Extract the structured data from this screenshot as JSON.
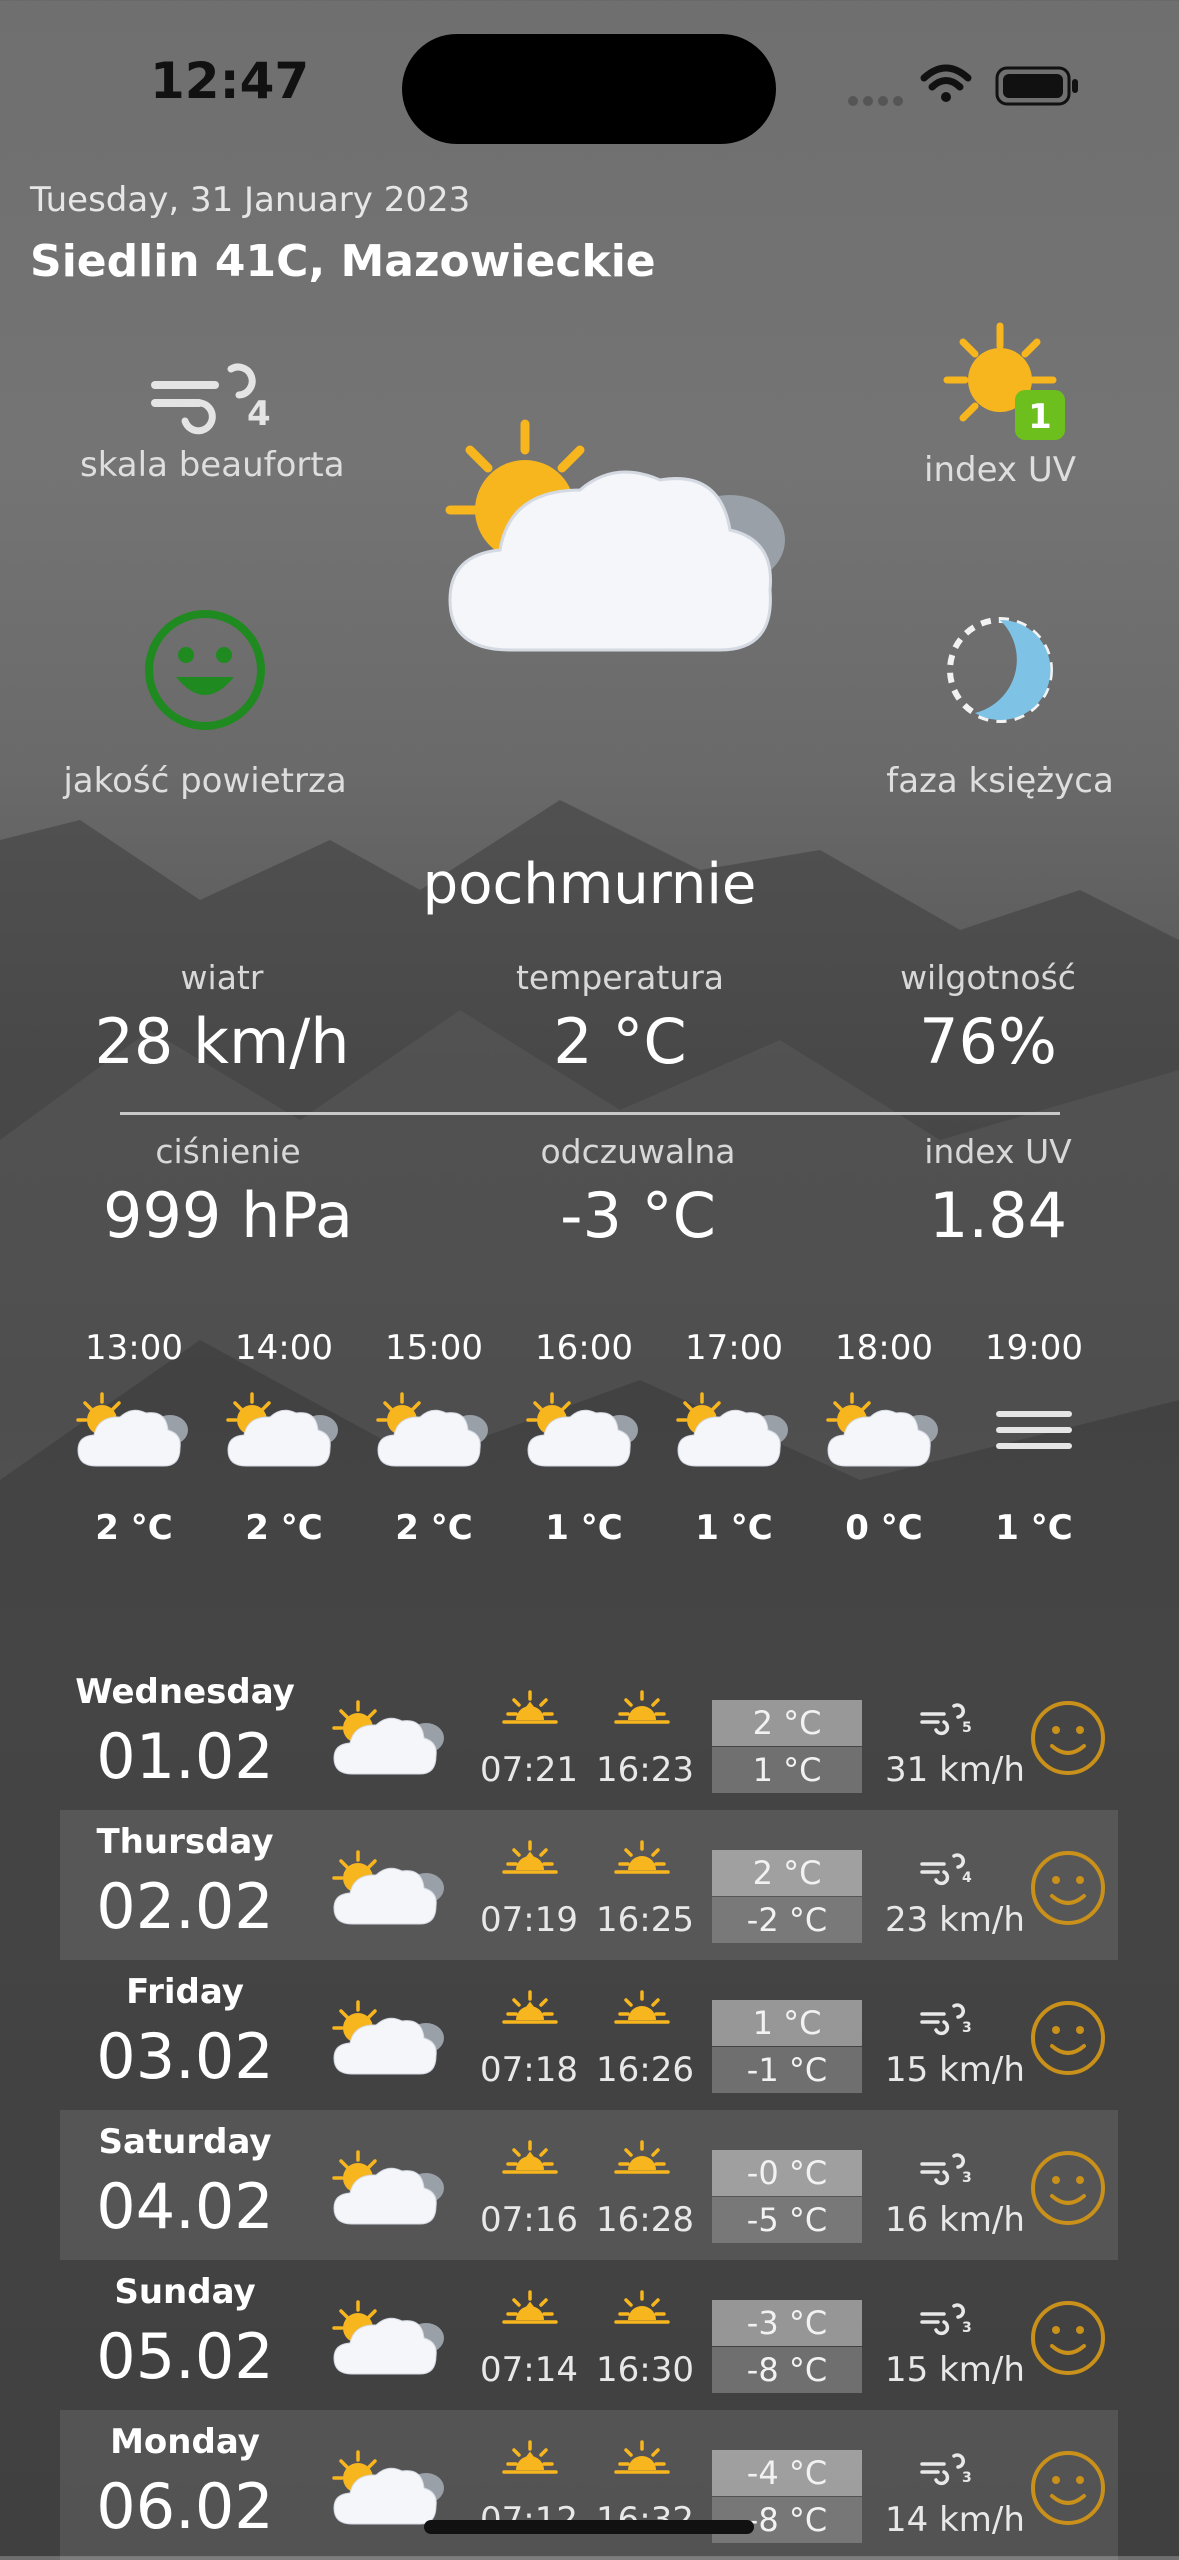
{
  "status_bar": {
    "time": "12:47"
  },
  "header": {
    "date": "Tuesday, 31 January 2023",
    "location": "Siedlin 41C, Mazowieckie"
  },
  "widgets": {
    "beaufort_label": "skala beauforta",
    "beaufort_value": "4",
    "uv_label": "index UV",
    "uv_value": "1",
    "air_label": "jakość powietrza",
    "moon_label": "faza księżyca"
  },
  "condition": "pochmurnie",
  "stats": {
    "wind_label": "wiatr",
    "wind_value": "28 km/h",
    "temp_label": "temperatura",
    "temp_value": "2 °C",
    "humidity_label": "wilgotność",
    "humidity_value": "76%",
    "pressure_label": "ciśnienie",
    "pressure_value": "999 hPa",
    "feels_label": "odczuwalna",
    "feels_value": "-3 °C",
    "uv_label": "index UV",
    "uv_value": "1.84"
  },
  "hourly": [
    {
      "time": "13:00",
      "temp": "2 °C",
      "icon": "partly-cloudy-icon"
    },
    {
      "time": "14:00",
      "temp": "2 °C",
      "icon": "partly-cloudy-icon"
    },
    {
      "time": "15:00",
      "temp": "2 °C",
      "icon": "partly-cloudy-icon"
    },
    {
      "time": "16:00",
      "temp": "1 °C",
      "icon": "partly-cloudy-icon"
    },
    {
      "time": "17:00",
      "temp": "1 °C",
      "icon": "partly-cloudy-icon"
    },
    {
      "time": "18:00",
      "temp": "0 °C",
      "icon": "partly-cloudy-icon"
    },
    {
      "time": "19:00",
      "temp": "1 °C",
      "icon": "fog-icon"
    }
  ],
  "daily": [
    {
      "day": "Wednesday",
      "date": "01.02",
      "sunrise": "07:21",
      "sunset": "16:23",
      "max": "2 °C",
      "min": "1 °C",
      "wind": "31 km/h",
      "beaufort": "5"
    },
    {
      "day": "Thursday",
      "date": "02.02",
      "sunrise": "07:19",
      "sunset": "16:25",
      "max": "2 °C",
      "min": "-2 °C",
      "wind": "23 km/h",
      "beaufort": "4"
    },
    {
      "day": "Friday",
      "date": "03.02",
      "sunrise": "07:18",
      "sunset": "16:26",
      "max": "1 °C",
      "min": "-1 °C",
      "wind": "15 km/h",
      "beaufort": "3"
    },
    {
      "day": "Saturday",
      "date": "04.02",
      "sunrise": "07:16",
      "sunset": "16:28",
      "max": "-0 °C",
      "min": "-5 °C",
      "wind": "16 km/h",
      "beaufort": "3"
    },
    {
      "day": "Sunday",
      "date": "05.02",
      "sunrise": "07:14",
      "sunset": "16:30",
      "max": "-3 °C",
      "min": "-8 °C",
      "wind": "15 km/h",
      "beaufort": "3"
    },
    {
      "day": "Monday",
      "date": "06.02",
      "sunrise": "07:12",
      "sunset": "16:32",
      "max": "-4 °C",
      "min": "-8 °C",
      "wind": "14 km/h",
      "beaufort": "3"
    }
  ],
  "colors": {
    "sun": "#f7b51e",
    "uv_badge": "#6cbf1c",
    "air_face": "#1f8a1f",
    "day_face": "#c9901a",
    "moon": "#7ec3e6"
  }
}
